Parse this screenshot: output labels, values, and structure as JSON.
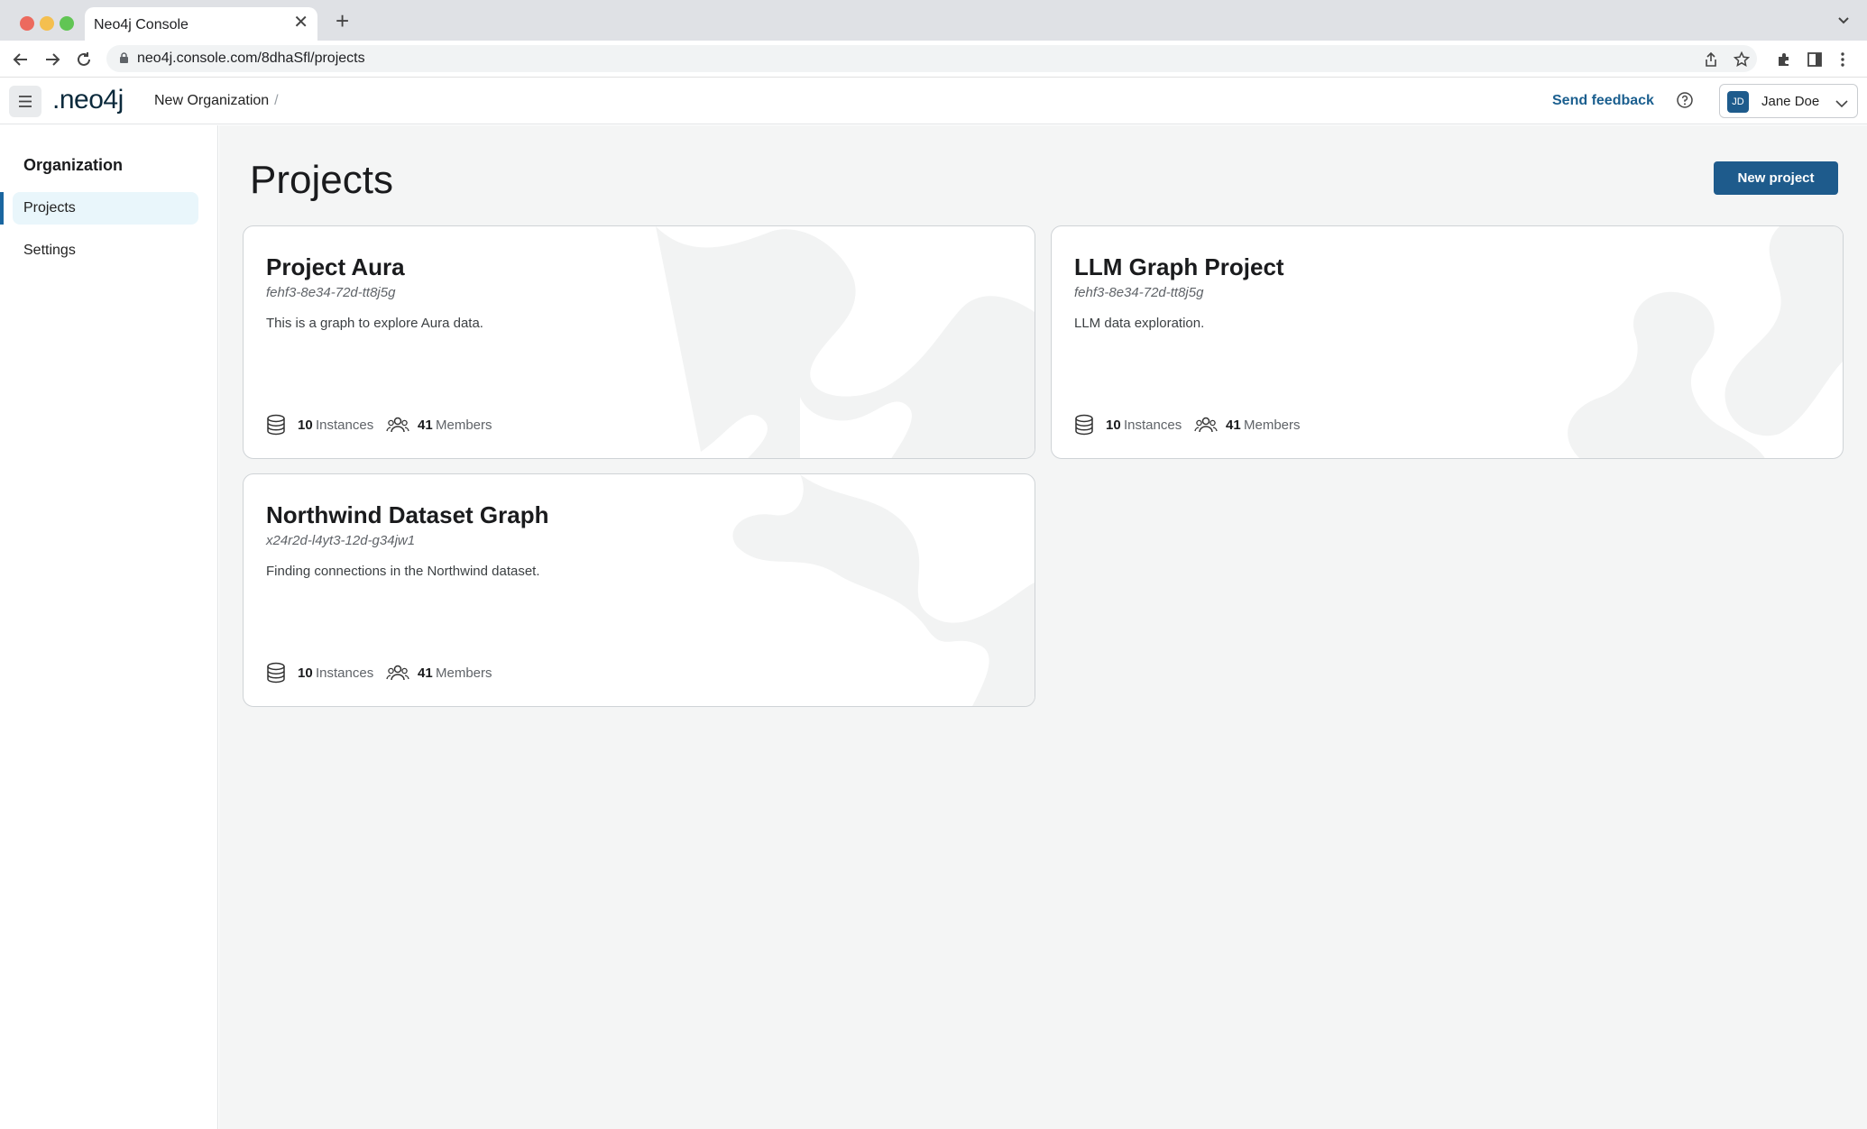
{
  "browser": {
    "tab_title": "Neo4j Console",
    "url": "neo4j.console.com/8dhaSfl/projects"
  },
  "header": {
    "logo": ".neo4j",
    "breadcrumb": "New Organization",
    "breadcrumb_sep": "/",
    "feedback": "Send feedback",
    "user": {
      "initials": "JD",
      "name": "Jane Doe"
    }
  },
  "sidebar": {
    "title": "Organization",
    "items": [
      {
        "label": "Projects",
        "active": true
      },
      {
        "label": "Settings",
        "active": false
      }
    ]
  },
  "main": {
    "title": "Projects",
    "new_button": "New project",
    "projects": [
      {
        "name": "Project Aura",
        "id": "fehf3-8e34-72d-tt8j5g",
        "description": "This is a graph to explore Aura data.",
        "instances": "10",
        "instances_label": "Instances",
        "members": "41",
        "members_label": "Members"
      },
      {
        "name": "LLM Graph Project",
        "id": "fehf3-8e34-72d-tt8j5g",
        "description": "LLM data exploration.",
        "instances": "10",
        "instances_label": "Instances",
        "members": "41",
        "members_label": "Members"
      },
      {
        "name": "Northwind Dataset Graph",
        "id": "x24r2d-l4yt3-12d-g34jw1",
        "description": "Finding connections in the Northwind dataset.",
        "instances": "10",
        "instances_label": "Instances",
        "members": "41",
        "members_label": "Members"
      }
    ]
  },
  "colors": {
    "primary": "#1e5b8c",
    "link": "#1b5f8f",
    "active_bg": "#e9f6fb"
  }
}
